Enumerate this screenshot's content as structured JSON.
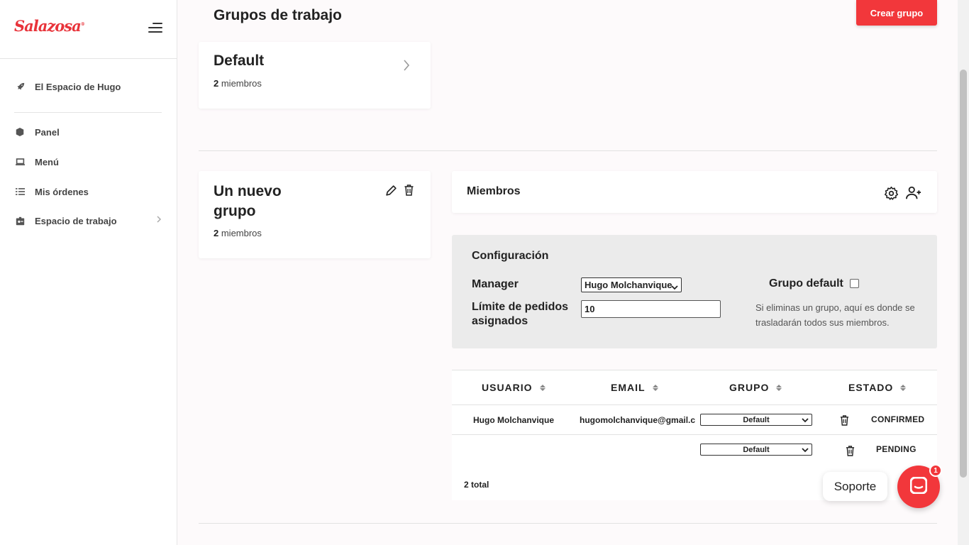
{
  "brand": {
    "logo_text": "Salazosa",
    "accent": "#f2373b"
  },
  "sidebar": {
    "workspace": "El Espacio de Hugo",
    "items": [
      {
        "label": "Panel",
        "icon": "box-icon"
      },
      {
        "label": "Menú",
        "icon": "laptop-icon"
      },
      {
        "label": "Mis órdenes",
        "icon": "list-icon"
      },
      {
        "label": "Espacio de trabajo",
        "icon": "id-badge-icon"
      }
    ]
  },
  "header": {
    "title": "Grupos de trabajo",
    "create_label": "Crear grupo"
  },
  "groups": [
    {
      "name": "Default",
      "count": "2",
      "count_suffix": " miembros"
    },
    {
      "name": "Un nuevo grupo",
      "count": "2",
      "count_suffix": " miembros"
    }
  ],
  "members": {
    "title": "Miembros",
    "config": {
      "title": "Configuración",
      "manager_label": "Manager",
      "manager_value": "Hugo Molchanvique",
      "limit_label_1": "Límite de pedidos",
      "limit_label_2": "asignados",
      "limit_value": "10",
      "default_label": "Grupo default",
      "hint": "Si eliminas un grupo, aquí es donde se trasladarán todos sus miembros."
    },
    "table": {
      "headers": [
        "USUARIO",
        "EMAIL",
        "GRUPO",
        "ESTADO"
      ],
      "rows": [
        {
          "user": "Hugo Molchanvique",
          "email": "hugomolchanvique@gmail.com",
          "group": "Default",
          "status": "CONFIRMED"
        },
        {
          "user": "",
          "email": "",
          "group": "Default",
          "status": "PENDING"
        }
      ],
      "total": "2 total"
    }
  },
  "support": {
    "label": "Soporte",
    "badge": "1"
  }
}
